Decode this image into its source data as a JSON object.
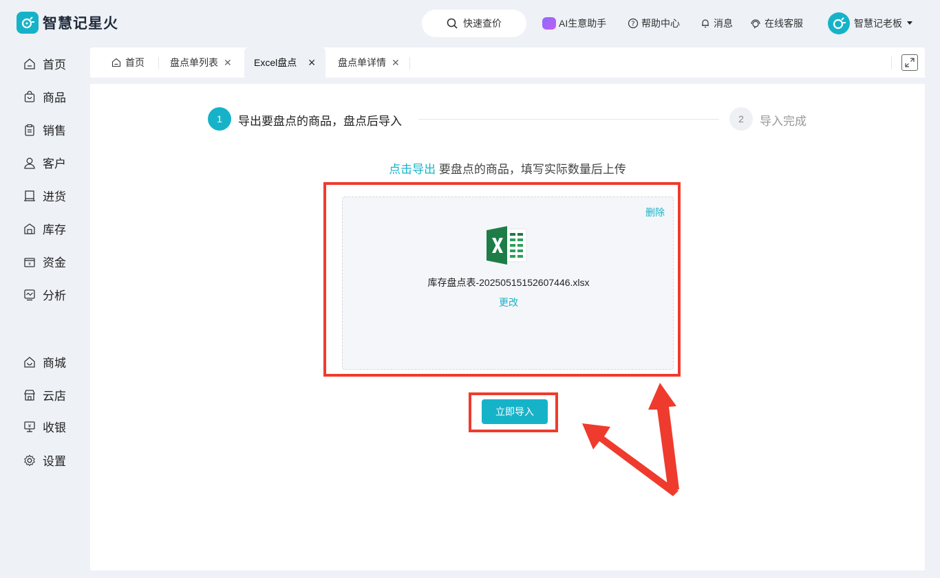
{
  "app": {
    "name": "智慧记星火"
  },
  "header": {
    "search_label": "快速查价",
    "ai_label": "AI生意助手",
    "help_label": "帮助中心",
    "messages_label": "消息",
    "service_label": "在线客服",
    "user_name": "智慧记老板"
  },
  "sidebar": {
    "items": [
      {
        "label": "首页",
        "icon": "home-icon"
      },
      {
        "label": "商品",
        "icon": "bag-icon"
      },
      {
        "label": "销售",
        "icon": "clipboard-icon"
      },
      {
        "label": "客户",
        "icon": "user-icon"
      },
      {
        "label": "进货",
        "icon": "purchase-icon"
      },
      {
        "label": "库存",
        "icon": "warehouse-icon"
      },
      {
        "label": "资金",
        "icon": "wallet-icon"
      },
      {
        "label": "分析",
        "icon": "chart-icon"
      },
      {
        "label": "商城",
        "icon": "mall-icon"
      },
      {
        "label": "云店",
        "icon": "store-icon"
      },
      {
        "label": "收银",
        "icon": "cashier-icon"
      },
      {
        "label": "设置",
        "icon": "gear-icon"
      }
    ]
  },
  "tabs": [
    {
      "label": "首页"
    },
    {
      "label": "盘点单列表"
    },
    {
      "label": "Excel盘点"
    },
    {
      "label": "盘点单详情"
    }
  ],
  "steps": [
    {
      "number": "1",
      "label": "导出要盘点的商品，盘点后导入"
    },
    {
      "number": "2",
      "label": "导入完成"
    }
  ],
  "instruction": {
    "link": "点击导出",
    "text": " 要盘点的商品，填写实际数量后上传"
  },
  "upload": {
    "delete_label": "删除",
    "file_name": "库存盘点表-20250515152607446.xlsx",
    "change_label": "更改"
  },
  "import_button": "立即导入",
  "colors": {
    "accent": "#16b3c8",
    "annotation": "#ef3b2d",
    "background": "#eef1f6"
  }
}
